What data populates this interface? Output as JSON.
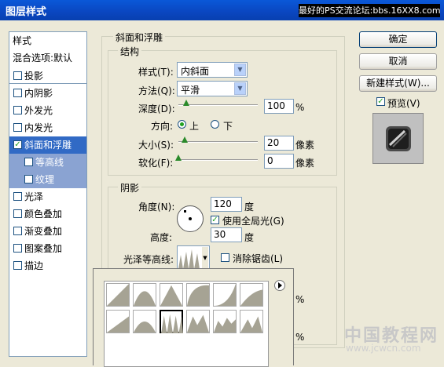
{
  "window": {
    "title": "图层样式",
    "banner": "最好的PS交流论坛:bbs.16XX8.com"
  },
  "sidebar": {
    "items": [
      {
        "label": "样式",
        "checked": null
      },
      {
        "label": "混合选项:默认",
        "checked": null
      },
      {
        "label": "投影",
        "checked": false
      },
      {
        "label": "内阴影",
        "checked": false
      },
      {
        "label": "外发光",
        "checked": false
      },
      {
        "label": "内发光",
        "checked": false
      },
      {
        "label": "斜面和浮雕",
        "checked": true
      },
      {
        "label": "等高线",
        "checked": false
      },
      {
        "label": "纹理",
        "checked": false
      },
      {
        "label": "光泽",
        "checked": false
      },
      {
        "label": "颜色叠加",
        "checked": false
      },
      {
        "label": "渐变叠加",
        "checked": false
      },
      {
        "label": "图案叠加",
        "checked": false
      },
      {
        "label": "描边",
        "checked": false
      }
    ]
  },
  "bevel": {
    "title": "斜面和浮雕",
    "structure": {
      "title": "结构",
      "style_label": "样式(T):",
      "style_value": "内斜面",
      "technique_label": "方法(Q):",
      "technique_value": "平滑",
      "depth_label": "深度(D):",
      "depth_value": "100",
      "depth_unit": "%",
      "depth_slider": 0.1,
      "direction_label": "方向:",
      "dir_up": "上",
      "dir_down": "下",
      "direction_selected": "上",
      "size_label": "大小(S):",
      "size_value": "20",
      "size_unit": "像素",
      "size_slider": 0.08,
      "soften_label": "软化(F):",
      "soften_value": "0",
      "soften_unit": "像素",
      "soften_slider": 0.0
    },
    "shading": {
      "title": "阴影",
      "angle_label": "角度(N):",
      "angle_value": "120",
      "angle_unit": "度",
      "global_light_label": "使用全局光(G)",
      "global_light_checked": true,
      "altitude_label": "高度:",
      "altitude_value": "30",
      "altitude_unit": "度",
      "gloss_label": "光泽等高线:",
      "antialias_label": "消除锯齿(L)",
      "antialias_checked": false
    },
    "hidden_units": [
      "%",
      "%"
    ]
  },
  "buttons": {
    "ok": "确定",
    "cancel": "取消",
    "new_style": "新建样式(W)...",
    "preview_label": "预览(V)",
    "preview_checked": true
  },
  "contour_picker": {
    "selected_index": 8,
    "count": 12
  },
  "watermark": {
    "main": "中国教程网",
    "url": "www.jcwcn.com"
  },
  "colors": {
    "title_bar": "#0a4fcc",
    "selection": "#316ac5",
    "check": "#21a121"
  }
}
